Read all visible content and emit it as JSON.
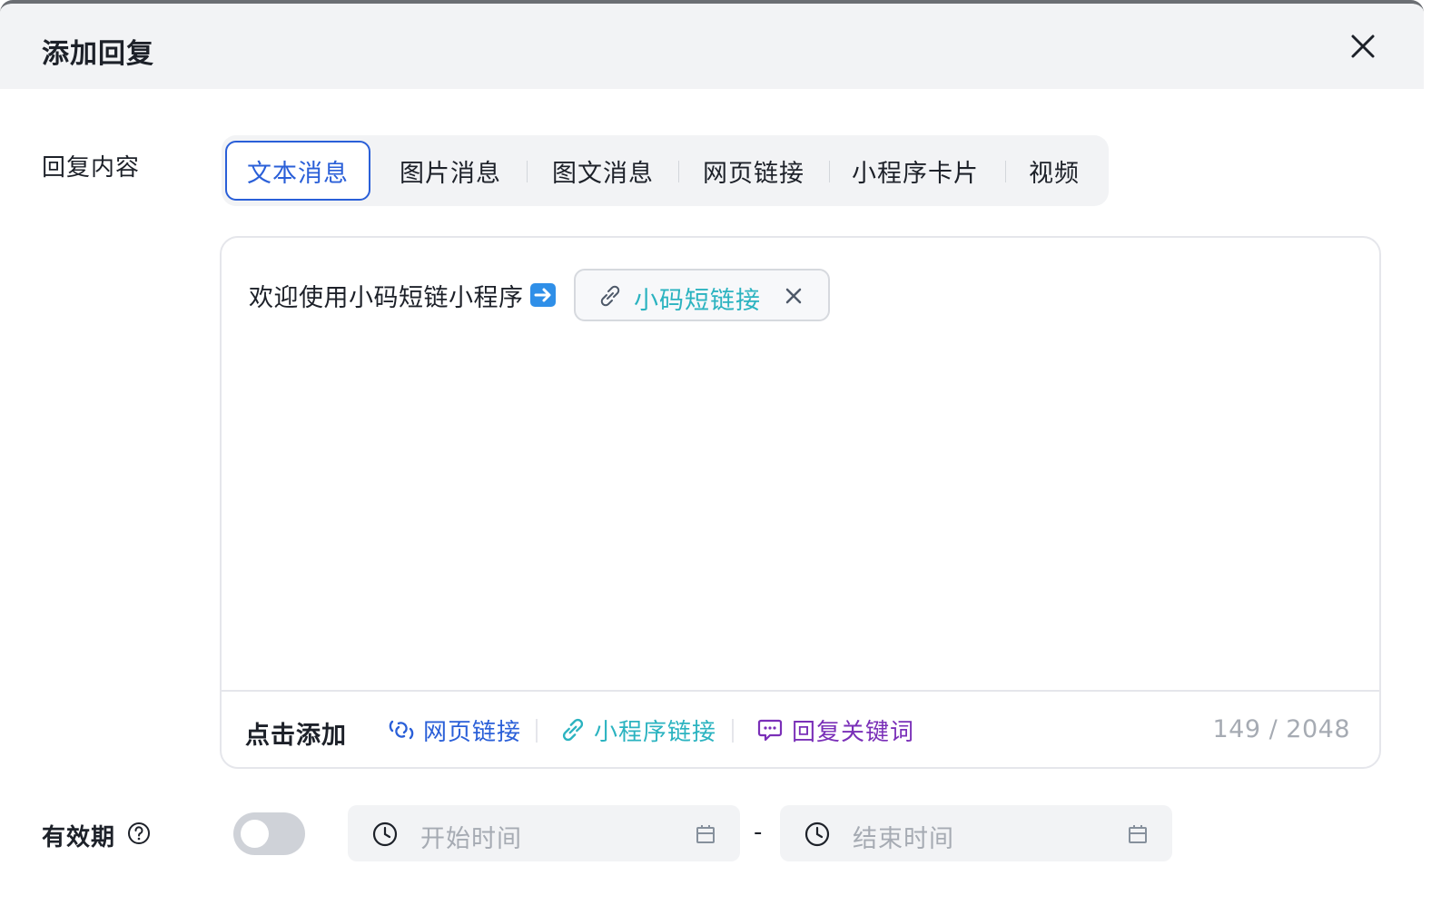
{
  "dialog": {
    "title": "添加回复"
  },
  "reply_content": {
    "label": "回复内容",
    "tabs": [
      {
        "label": "文本消息",
        "active": true
      },
      {
        "label": "图片消息",
        "active": false
      },
      {
        "label": "图文消息",
        "active": false
      },
      {
        "label": "网页链接",
        "active": false
      },
      {
        "label": "小程序卡片",
        "active": false
      },
      {
        "label": "视频",
        "active": false
      }
    ]
  },
  "editor": {
    "text": "欢迎使用小码短链小程序",
    "emoji": "arrow-right-emoji",
    "chip_label": "小码短链接",
    "footer_label": "点击添加",
    "insert_buttons": [
      {
        "label": "网页链接",
        "color": "#2a5fd8",
        "icon": "web-link-icon"
      },
      {
        "label": "小程序链接",
        "color": "#2bb3c0",
        "icon": "mini-program-link-icon"
      },
      {
        "label": "回复关键词",
        "color": "#7a2fb8",
        "icon": "chat-bubble-icon"
      }
    ],
    "counter": "149 / 2048"
  },
  "validity": {
    "label": "有效期",
    "enabled": false,
    "start_placeholder": "开始时间",
    "separator": "-",
    "end_placeholder": "结束时间"
  },
  "colors": {
    "primary": "#2a5fd8",
    "teal": "#2bb3c0",
    "purple": "#7a2fb8",
    "placeholder": "#a6abb3"
  }
}
